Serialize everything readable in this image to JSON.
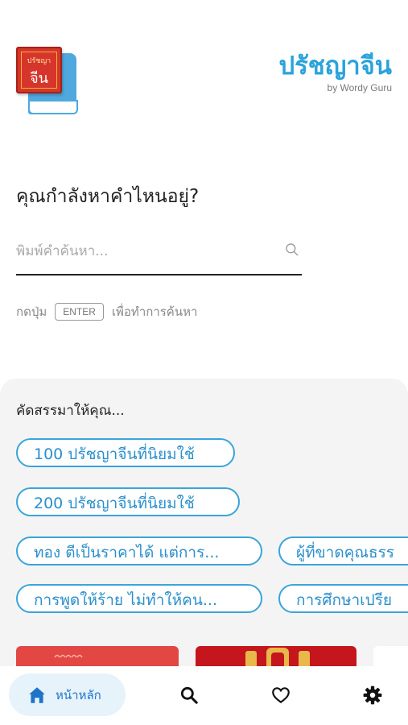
{
  "header": {
    "logo_line1": "ปรัชญา",
    "logo_line2": "จีน",
    "title": "ปรัชญาจีน",
    "subtitle": "by Wordy Guru"
  },
  "search": {
    "question": "คุณกำลังหาคำไหนอยู่?",
    "placeholder": "พิมพ์คำค้นหา...",
    "value": "",
    "hint_before": "กดปุ่ม",
    "enter_key": "ENTER",
    "hint_after": "เพื่อทำการค้นหา"
  },
  "recommend": {
    "title": "คัดสรรมาให้คุณ...",
    "chips": [
      "100 ปรัชญาจีนที่นิยมใช้",
      "200 ปรัชญาจีนที่นิยมใช้",
      "ทอง ตีเป็นราคาได้ แต่การ...",
      "ผู้ที่ขาดคุณธรร",
      "การพูดให้ร้าย ไม่ทำให้คน...",
      "การศึกษาเปรีย"
    ]
  },
  "nav": {
    "home_label": "หน้าหลัก",
    "icons": [
      "home-icon",
      "search-icon",
      "heart-icon",
      "gear-icon"
    ]
  },
  "colors": {
    "accent": "#2aa3db",
    "chip_border": "#3aa4db",
    "nav_active_bg": "#e6f3fb",
    "nav_active": "#1d74c9",
    "logo_red": "#d6352b"
  }
}
